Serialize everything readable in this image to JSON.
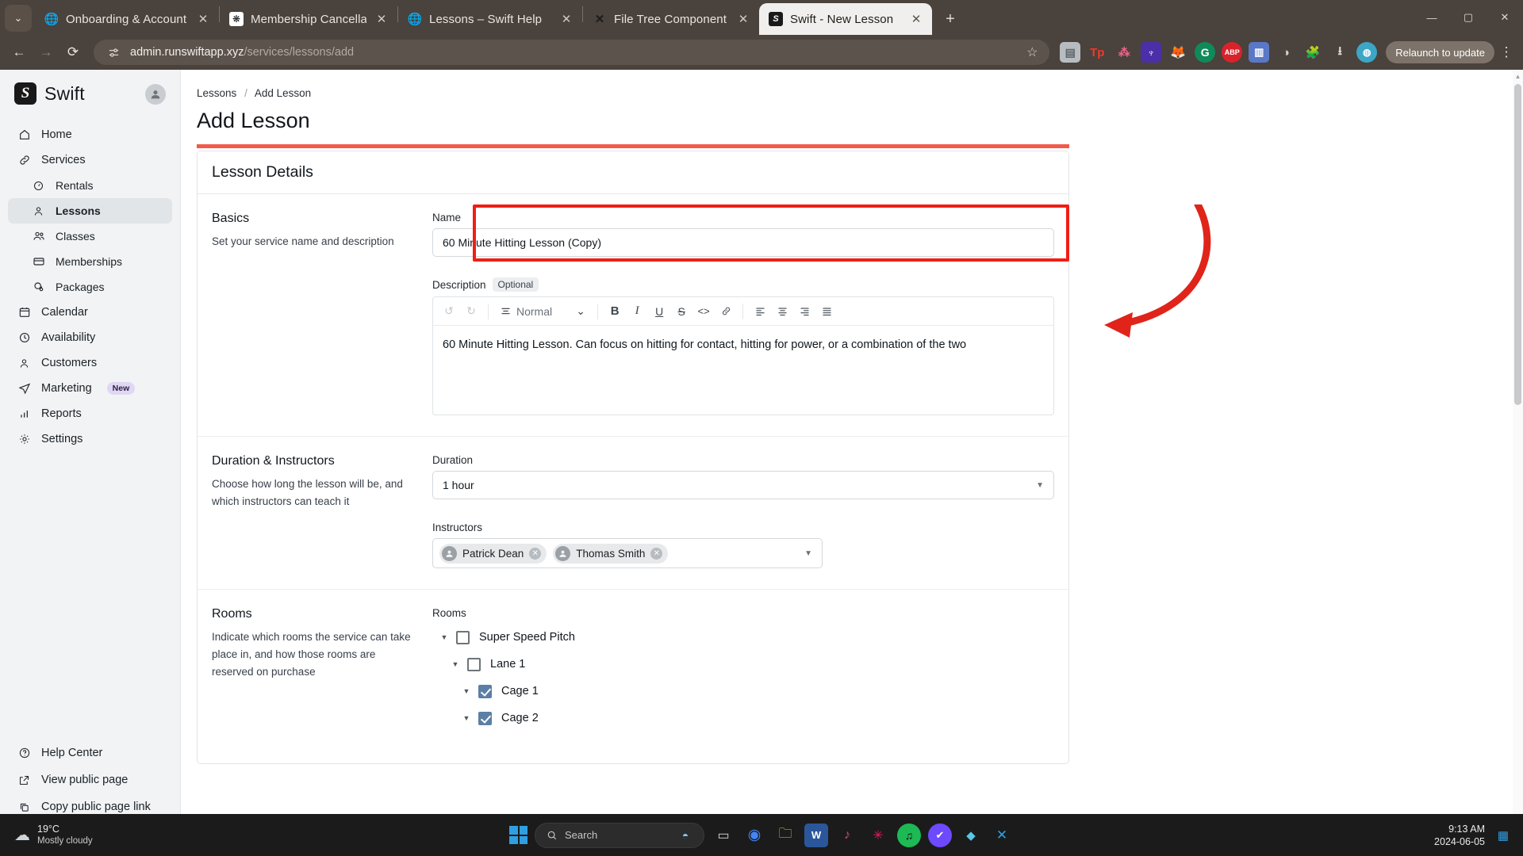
{
  "browser": {
    "tabs": [
      {
        "title": "Onboarding & Account Setup –",
        "favicon": "globe-icon",
        "active": false
      },
      {
        "title": "Membership Cancellation Instru",
        "favicon": "openai-icon",
        "active": false
      },
      {
        "title": "Lessons – Swift Help",
        "favicon": "globe-icon",
        "active": false
      },
      {
        "title": "File Tree Component – Nextra",
        "favicon": "nextra-icon",
        "active": false
      },
      {
        "title": "Swift - New Lesson",
        "favicon": "swift-icon",
        "active": true
      }
    ],
    "new_tab_label": "+",
    "tab_list_label": "⌄",
    "window_controls": {
      "minimize": "—",
      "maximize": "▢",
      "close": "✕"
    },
    "nav": {
      "back": "←",
      "forward": "→",
      "reload": "⟳"
    },
    "omnibox": {
      "site_settings_icon": "tune-icon",
      "url_host": "admin.runswiftapp.xyz",
      "url_path": "/services/lessons/add",
      "bookmark_icon": "star-icon"
    },
    "extensions": [
      {
        "name": "sidebar-extension-icon",
        "glyph": "▤",
        "bg": "#b7bcc1",
        "fg": "#5a5f64"
      },
      {
        "name": "toolpad-extension-icon",
        "glyph": "Tp",
        "bg": "transparent",
        "fg": "#f0392b"
      },
      {
        "name": "pink-extension-icon",
        "glyph": "⣿",
        "bg": "transparent",
        "fg": "#f4628c"
      },
      {
        "name": "wallet-extension-icon",
        "glyph": "♆",
        "bg": "#4b2fa8",
        "fg": "#ffffff"
      },
      {
        "name": "metamask-extension-icon",
        "glyph": "🦊",
        "bg": "transparent",
        "fg": "#e2761b"
      },
      {
        "name": "grammarly-extension-icon",
        "glyph": "G",
        "bg": "#108a5a",
        "fg": "#ffffff"
      },
      {
        "name": "adblock-extension-icon",
        "glyph": "ABP",
        "bg": "#d8232a",
        "fg": "#ffffff"
      }
    ],
    "download_icon": "download-icon",
    "profile_icon": "profile-icon",
    "puzzle_icon": "extensions-puzzle-icon",
    "relaunch_label": "Relaunch to update",
    "menu_icon": "kebab-menu-icon"
  },
  "sidebar": {
    "brand": {
      "logo": "S",
      "name": "Swift"
    },
    "account_icon": "account-avatar-icon",
    "items": [
      {
        "label": "Home",
        "icon": "home-icon",
        "sub": false,
        "active": false
      },
      {
        "label": "Services",
        "icon": "link-icon",
        "sub": false,
        "active": false
      },
      {
        "label": "Rentals",
        "icon": "gauge-icon",
        "sub": true,
        "active": false
      },
      {
        "label": "Lessons",
        "icon": "person-icon",
        "sub": true,
        "active": true
      },
      {
        "label": "Classes",
        "icon": "people-icon",
        "sub": true,
        "active": false
      },
      {
        "label": "Memberships",
        "icon": "card-icon",
        "sub": true,
        "active": false
      },
      {
        "label": "Packages",
        "icon": "coins-icon",
        "sub": true,
        "active": false
      },
      {
        "label": "Calendar",
        "icon": "calendar-icon",
        "sub": false,
        "active": false
      },
      {
        "label": "Availability",
        "icon": "clock-icon",
        "sub": false,
        "active": false
      },
      {
        "label": "Customers",
        "icon": "person-icon",
        "sub": false,
        "active": false
      },
      {
        "label": "Marketing",
        "icon": "send-icon",
        "sub": false,
        "active": false,
        "badge": "New"
      },
      {
        "label": "Reports",
        "icon": "bars-icon",
        "sub": false,
        "active": false
      },
      {
        "label": "Settings",
        "icon": "gear-icon",
        "sub": false,
        "active": false
      }
    ],
    "bottom_items": [
      {
        "label": "Help Center",
        "icon": "question-circle-icon"
      },
      {
        "label": "View public page",
        "icon": "external-link-icon"
      },
      {
        "label": "Copy public page link",
        "icon": "copy-icon"
      }
    ]
  },
  "main": {
    "breadcrumb": {
      "parent": "Lessons",
      "separator": "/",
      "current": "Add Lesson"
    },
    "page_title": "Add Lesson",
    "card_title": "Lesson Details",
    "sections": {
      "basics": {
        "title": "Basics",
        "description": "Set your service name and description",
        "name_label": "Name",
        "name_value": "60 Minute Hitting Lesson (Copy)",
        "description_label": "Description",
        "optional_chip": "Optional",
        "editor": {
          "undo_icon": "undo-icon",
          "redo_icon": "redo-icon",
          "format_icon": "paragraph-format-icon",
          "format_value": "Normal",
          "format_caret": "chevron-down-icon",
          "bold": "B",
          "italic": "I",
          "underline": "U",
          "strike": "S",
          "code": "<>",
          "link": "link-icon",
          "align_left": "align-left-icon",
          "align_center": "align-center-icon",
          "align_right": "align-right-icon",
          "align_justify": "align-justify-icon"
        },
        "editor_body": "60 Minute Hitting Lesson. Can focus on hitting for contact, hitting for power, or a combination of the two"
      },
      "duration": {
        "title": "Duration & Instructors",
        "description": "Choose how long the lesson will be, and which instructors can teach it",
        "duration_label": "Duration",
        "duration_value": "1 hour",
        "instructors_label": "Instructors",
        "instructors": [
          {
            "name": "Patrick Dean",
            "avatar": "person-avatar-icon",
            "remove": "remove-icon"
          },
          {
            "name": "Thomas Smith",
            "avatar": "person-avatar-icon",
            "remove": "remove-icon"
          }
        ]
      },
      "rooms": {
        "title": "Rooms",
        "description": "Indicate which rooms the service can take place in, and how those rooms are reserved on purchase",
        "rooms_label": "Rooms",
        "tree": [
          {
            "label": "Super Speed Pitch",
            "checked": false,
            "depth": 0
          },
          {
            "label": "Lane 1",
            "checked": false,
            "depth": 1
          },
          {
            "label": "Cage 1",
            "checked": true,
            "depth": 2
          },
          {
            "label": "Cage 2",
            "checked": true,
            "depth": 2
          }
        ]
      }
    }
  },
  "annotation": {
    "color": "#f01e14",
    "arrow_color": "#e0241a",
    "highlight_color": "#f25a4b"
  },
  "taskbar": {
    "weather": {
      "temp": "19°C",
      "condition": "Mostly cloudy",
      "icon": "cloud-icon"
    },
    "start_icon": "windows-start-icon",
    "search_placeholder": "Search",
    "search_icon": "search-icon",
    "apps": [
      {
        "name": "taskview-icon",
        "glyph": "▭",
        "bg": "#3a3a3a",
        "fg": "#d8d8d8"
      },
      {
        "name": "widgets-icon",
        "glyph": "▣",
        "bg": "#4a4a4a",
        "fg": "#e6e6e6"
      },
      {
        "name": "chrome-icon",
        "glyph": "◉",
        "bg": "transparent",
        "fg": "#4285f4"
      },
      {
        "name": "file-explorer-icon",
        "glyph": "🗀",
        "bg": "transparent",
        "fg": "#f6b93b"
      },
      {
        "name": "word-icon",
        "glyph": "W",
        "bg": "#2b579a",
        "fg": "#ffffff"
      },
      {
        "name": "music-icon",
        "glyph": "♪",
        "bg": "transparent",
        "fg": "#d84a6b"
      },
      {
        "name": "slack-icon",
        "glyph": "✳",
        "bg": "transparent",
        "fg": "#e01e5a"
      },
      {
        "name": "spotify-icon",
        "glyph": "♫",
        "bg": "#1db954",
        "fg": "#000000"
      },
      {
        "name": "protonvpn-icon",
        "glyph": "✔",
        "bg": "#6d4aff",
        "fg": "#ffffff"
      },
      {
        "name": "gitkraken-icon",
        "glyph": "◆",
        "bg": "transparent",
        "fg": "#5bc6e8"
      },
      {
        "name": "vscode-icon",
        "glyph": "✕",
        "bg": "transparent",
        "fg": "#2f9fe3"
      }
    ],
    "tray": {
      "show_hidden": "^",
      "network": "▲",
      "volume": "♪",
      "action_center": "▣"
    },
    "clock": {
      "time": "9:13 AM",
      "date": "2024-06-05"
    }
  }
}
